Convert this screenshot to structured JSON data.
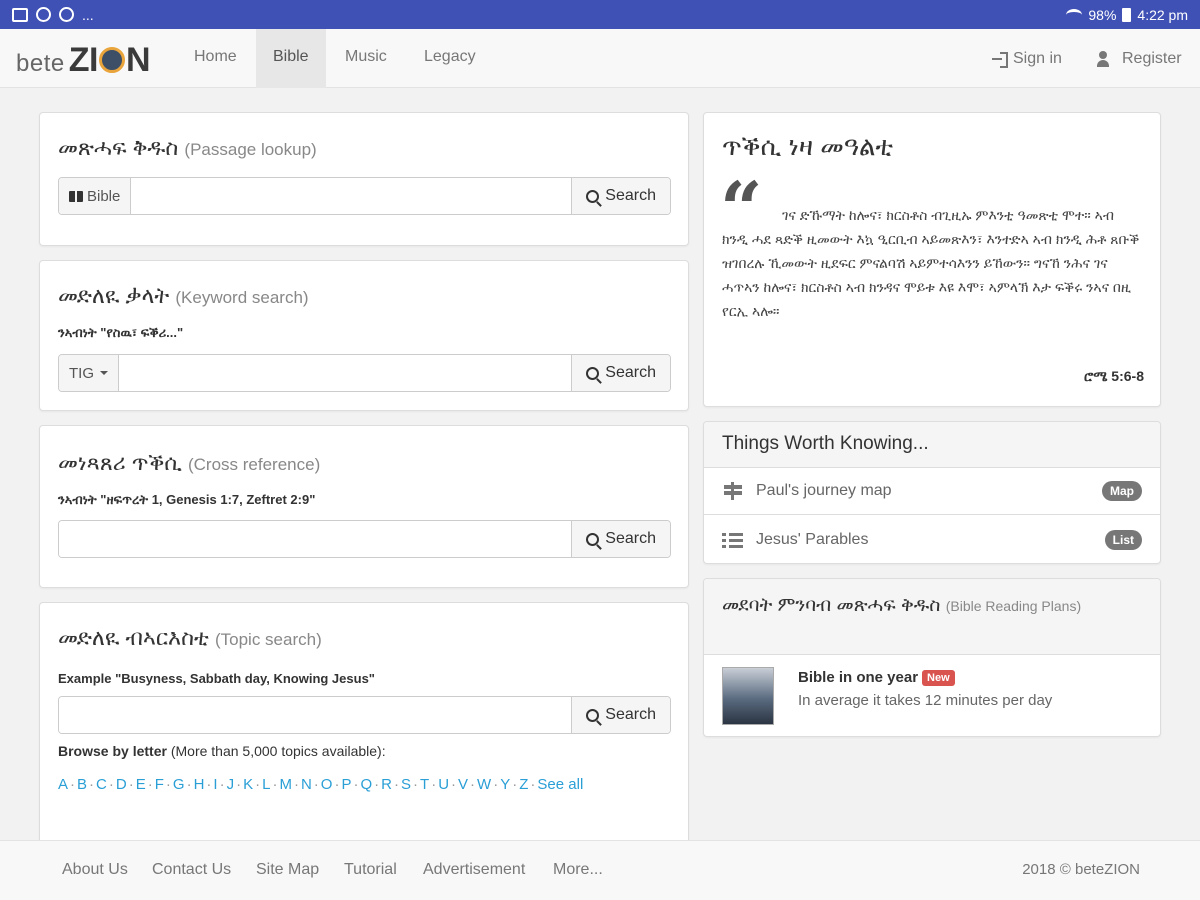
{
  "statusbar": {
    "left": "...",
    "battery": "98%",
    "time": "4:22 pm"
  },
  "brand": {
    "a": "bete",
    "b1": "ZI",
    "b2": "N"
  },
  "nav": {
    "home": "Home",
    "bible": "Bible",
    "music": "Music",
    "legacy": "Legacy",
    "signin": "Sign in",
    "register": "Register"
  },
  "passage": {
    "title": "መጽሓፍ ቅዱስ",
    "sub": "(Passage lookup)",
    "addon": "Bible",
    "search_label": "Search"
  },
  "keyword": {
    "title": "መድለዪ ቃላት",
    "sub": "(Keyword search)",
    "hint": "ንኣብነት \"የስዉ፣ ፍቕሪ...\"",
    "addon": "TIG",
    "search_label": "Search"
  },
  "crossref": {
    "title": "መነጻጸሪ ጥቕሲ",
    "sub": "(Cross reference)",
    "hint": "ንኣብነት \"ዘፍጥረት 1, Genesis 1:7, Zeftret 2:9\"",
    "search_label": "Search"
  },
  "topic": {
    "title": "መድለዪ ብኣርእስቲ",
    "sub": "(Topic search)",
    "hint": "Example \"Busyness, Sabbath day, Knowing Jesus\"",
    "search_label": "Search",
    "browse_bold": "Browse by letter",
    "browse_rest": " (More than 5,000 topics available):",
    "letters": [
      "A",
      "B",
      "C",
      "D",
      "E",
      "F",
      "G",
      "H",
      "I",
      "J",
      "K",
      "L",
      "M",
      "N",
      "O",
      "P",
      "Q",
      "R",
      "S",
      "T",
      "U",
      "V",
      "W",
      "Y",
      "Z"
    ],
    "see_all": "See all"
  },
  "verse": {
    "title": "ጥቕሲ ነዛ መዓልቲ",
    "text": "ገና ድኹማት ከሎና፣ ክርስቶስ ብጊዚኡ ምእንቲ ዓመጽቲ ሞተ። ኣብ ክንዲ ሓደ ጻድቕ ዚመውት እኳ ዒርቢብ ኣይመጽእን፣ እንተድኣ ኣብ ክንዲ ሕቶ ጸቡቕ ዝገበረሉ ኺመውት ዚደፍር ምናልባሽ ኣይምተሳእንን ይኸውን። ግናኸ ንሕና ገና ሓጥኣን ከሎና፣ ክርስቶስ ኣብ ክንዳና ሞይቱ እዩ እሞ፣ ኣምላኽ እታ ፍቕሩ ንኣና በዚ የርኢ ኣሎ።",
    "ref": "ሮሜ 5:6-8"
  },
  "worth": {
    "title": "Things Worth Knowing...",
    "items": [
      {
        "label": "Paul's journey map",
        "badge": "Map"
      },
      {
        "label": "Jesus' Parables",
        "badge": "List"
      }
    ]
  },
  "plans": {
    "title": "መደባት ምንባብ መጽሓፍ ቅዱስ",
    "sub": "(Bible Reading Plans)",
    "name": "Bible in one year",
    "new_badge": "New",
    "desc": "In average it takes 12 minutes per day"
  },
  "footer": {
    "links": [
      "About Us",
      "Contact Us",
      "Site Map",
      "Tutorial",
      "Advertisement",
      "More..."
    ],
    "copy": "2018 © beteZION"
  }
}
